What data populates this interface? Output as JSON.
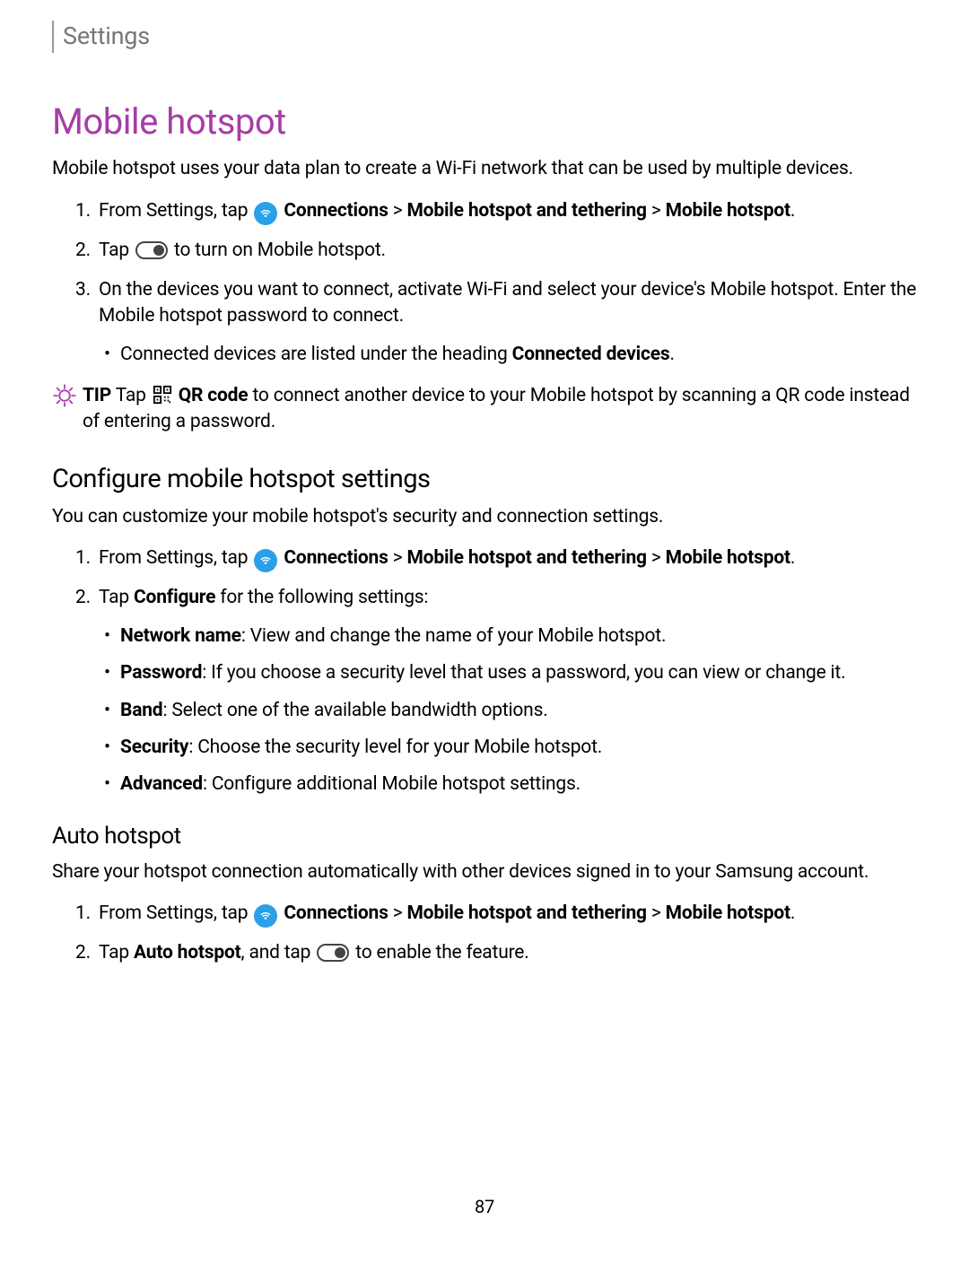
{
  "header": "Settings",
  "title": "Mobile hotspot",
  "intro": "Mobile hotspot uses your data plan to create a Wi-Fi network that can be used by multiple devices.",
  "steps1": {
    "s1_pre": "From Settings, tap ",
    "s1_b1": "Connections",
    "s1_gt1": " > ",
    "s1_b2": "Mobile hotspot and tethering",
    "s1_gt2": " > ",
    "s1_b3": "Mobile hotspot",
    "s1_end": ".",
    "s2_pre": "Tap ",
    "s2_post": " to turn on Mobile hotspot.",
    "s3": "On the devices you want to connect, activate Wi-Fi and select your device's Mobile hotspot. Enter the Mobile hotspot password to connect.",
    "s3_sub_pre": "Connected devices are listed under the heading ",
    "s3_sub_b": "Connected devices",
    "s3_sub_end": "."
  },
  "tip": {
    "label": "TIP",
    "pre": "  Tap ",
    "b1": "QR code",
    "post": " to connect another device to your Mobile hotspot by scanning a QR code instead of entering a password."
  },
  "configure": {
    "title": "Configure mobile hotspot settings",
    "intro": "You can customize your mobile hotspot's security and connection settings.",
    "s1_pre": "From Settings, tap ",
    "s1_b1": "Connections",
    "s1_gt1": " > ",
    "s1_b2": "Mobile hotspot and tethering",
    "s1_gt2": " > ",
    "s1_b3": "Mobile hotspot",
    "s1_end": ".",
    "s2_pre": "Tap ",
    "s2_b": "Configure",
    "s2_post": " for the following settings:",
    "items": {
      "i1_b": "Network name",
      "i1_t": ": View and change the name of your Mobile hotspot.",
      "i2_b": "Password",
      "i2_t": ": If you choose a security level that uses a password, you can view or change it.",
      "i3_b": "Band",
      "i3_t": ": Select one of the available bandwidth options.",
      "i4_b": "Security",
      "i4_t": ": Choose the security level for your Mobile hotspot.",
      "i5_b": "Advanced",
      "i5_t": ": Configure additional Mobile hotspot settings."
    }
  },
  "auto": {
    "title": "Auto hotspot",
    "intro": "Share your hotspot connection automatically with other devices signed in to your Samsung account.",
    "s1_pre": "From Settings, tap ",
    "s1_b1": "Connections",
    "s1_gt1": " > ",
    "s1_b2": "Mobile hotspot and tethering",
    "s1_gt2": " > ",
    "s1_b3": "Mobile hotspot",
    "s1_end": ".",
    "s2_pre": "Tap ",
    "s2_b": "Auto hotspot",
    "s2_mid": ", and tap ",
    "s2_post": " to enable the feature."
  },
  "page": "87"
}
